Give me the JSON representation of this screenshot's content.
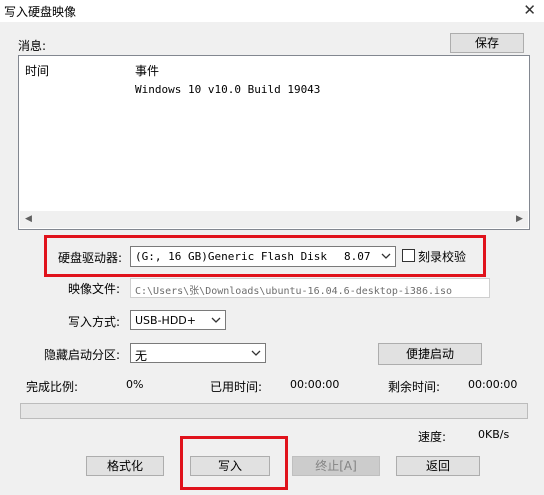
{
  "window": {
    "title": "写入硬盘映像"
  },
  "messages": {
    "label": "消息:",
    "save_button": "保存",
    "columns": [
      "时间",
      "事件"
    ],
    "rows": [
      {
        "time": "",
        "event": "Windows 10 v10.0 Build 19043"
      }
    ]
  },
  "drive": {
    "label": "硬盘驱动器:",
    "value": "(G:, 16 GB)Generic Flash Disk",
    "version": "8.07",
    "verify_label": "刻录校验",
    "verify_checked": false
  },
  "image_file": {
    "label": "映像文件:",
    "value": "C:\\Users\\张\\Downloads\\ubuntu-16.04.6-desktop-i386.iso"
  },
  "write_mode": {
    "label": "写入方式:",
    "value": "USB-HDD+"
  },
  "hidden_partition": {
    "label": "隐藏启动分区:",
    "value": "无"
  },
  "quick_boot_button": "便捷启动",
  "stats": {
    "completed_label": "完成比例:",
    "completed_value": "0%",
    "elapsed_label": "已用时间:",
    "elapsed_value": "00:00:00",
    "remaining_label": "剩余时间:",
    "remaining_value": "00:00:00",
    "progress": 0,
    "speed_label": "速度:",
    "speed_value": "0KB/s"
  },
  "buttons": {
    "format": "格式化",
    "write": "写入",
    "stop": "终止[A]",
    "back": "返回"
  },
  "colors": {
    "highlight": "#e0121b",
    "progress": "#06b025"
  }
}
